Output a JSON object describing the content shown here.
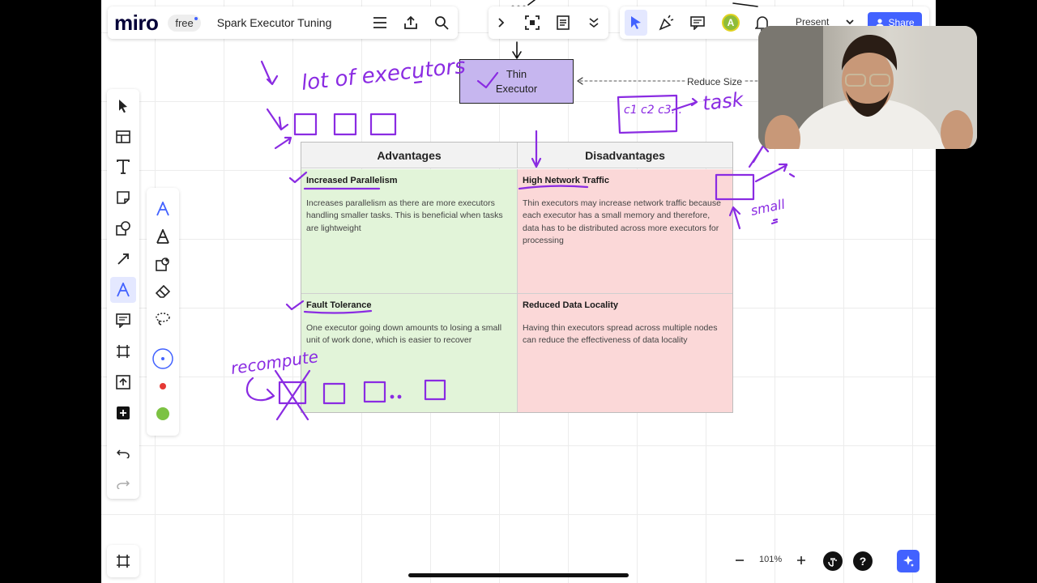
{
  "app": {
    "logo": "miro",
    "plan_badge": "free",
    "board_title": "Spark Executor Tuning",
    "avatar_initial": "A",
    "present_label": "Present",
    "share_label": "Share",
    "accent_color": "#4262ff"
  },
  "board": {
    "thin_executor_label": "Thin Executor",
    "reduce_size_label": "Reduce Size",
    "matrix": {
      "headers": [
        "Advantages",
        "Disadvantages"
      ],
      "cells": [
        {
          "title": "Increased Parallelism",
          "text": "Increases parallelism as there are more executors handling smaller tasks. This is beneficial when tasks are lightweight"
        },
        {
          "title": "High Network Traffic",
          "text": "Thin executors may increase network traffic because each executor has a small memory and therefore, data has to be distributed across more executors for processing"
        },
        {
          "title": "Fault Tolerance",
          "text": "One executor going down amounts to losing a small unit of work done, which is easier to recover"
        },
        {
          "title": "Reduced Data Locality",
          "text": "Having thin executors spread across multiple nodes can reduce the effectiveness of data locality"
        }
      ],
      "colors": {
        "advantage": "#e2f4d9",
        "disadvantage": "#fbd8d8"
      }
    },
    "handwriting": {
      "lot_of_executors": "lot of executors",
      "task": "task",
      "task_blocks": "c1 c2 c3...",
      "small": "small",
      "recompute": "recompute",
      "ink_color": "#8a2be2"
    }
  },
  "toolbar": {
    "tools": [
      "select-icon",
      "templates-icon",
      "text-icon",
      "sticky-note-icon",
      "shapes-icon",
      "connector-icon",
      "pen-icon",
      "comment-icon",
      "frame-icon",
      "upload-icon",
      "add-icon",
      "undo-icon",
      "redo-icon"
    ],
    "pen_tools": [
      "pen-icon",
      "highlighter-icon",
      "smart-draw-icon",
      "eraser-icon",
      "lasso-icon",
      "blue-color",
      "red-color",
      "green-color"
    ]
  },
  "zoom": {
    "level": "101%"
  }
}
